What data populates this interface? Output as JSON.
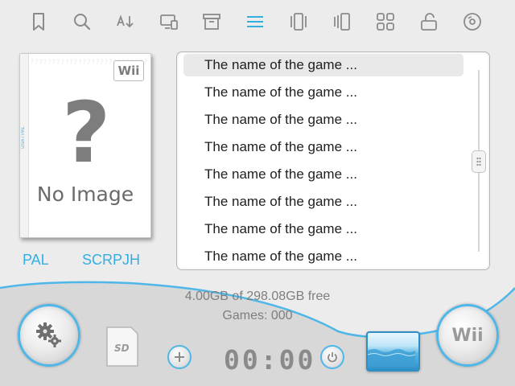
{
  "toolbar": {
    "icons": [
      "bookmark-icon",
      "search-icon",
      "sort-icon",
      "display-icon",
      "archive-icon",
      "list-view-icon",
      "carousel-view-icon",
      "coverflow-view-icon",
      "grid-view-icon",
      "unlock-icon",
      "disc-icon"
    ],
    "active": "list-view-icon"
  },
  "cover": {
    "placeholder_text": "No Image",
    "logo_text": "Wii"
  },
  "game_info": {
    "region": "PAL",
    "game_id": "SCRPJH"
  },
  "game_list": {
    "items": [
      "The name of the game ...",
      "The name of the game ...",
      "The name of the game ...",
      "The name of the game ...",
      "The name of the game ...",
      "The name of the game ...",
      "The name of the game ...",
      "The name of the game ..."
    ],
    "selected_index": 0
  },
  "status": {
    "free_space": "4.00GB of 298.08GB free",
    "games_count": "Games: 000",
    "clock": "00:00"
  },
  "buttons": {
    "wii_label": "Wii"
  },
  "colors": {
    "accent": "#35aee0",
    "background": "#ececec"
  }
}
